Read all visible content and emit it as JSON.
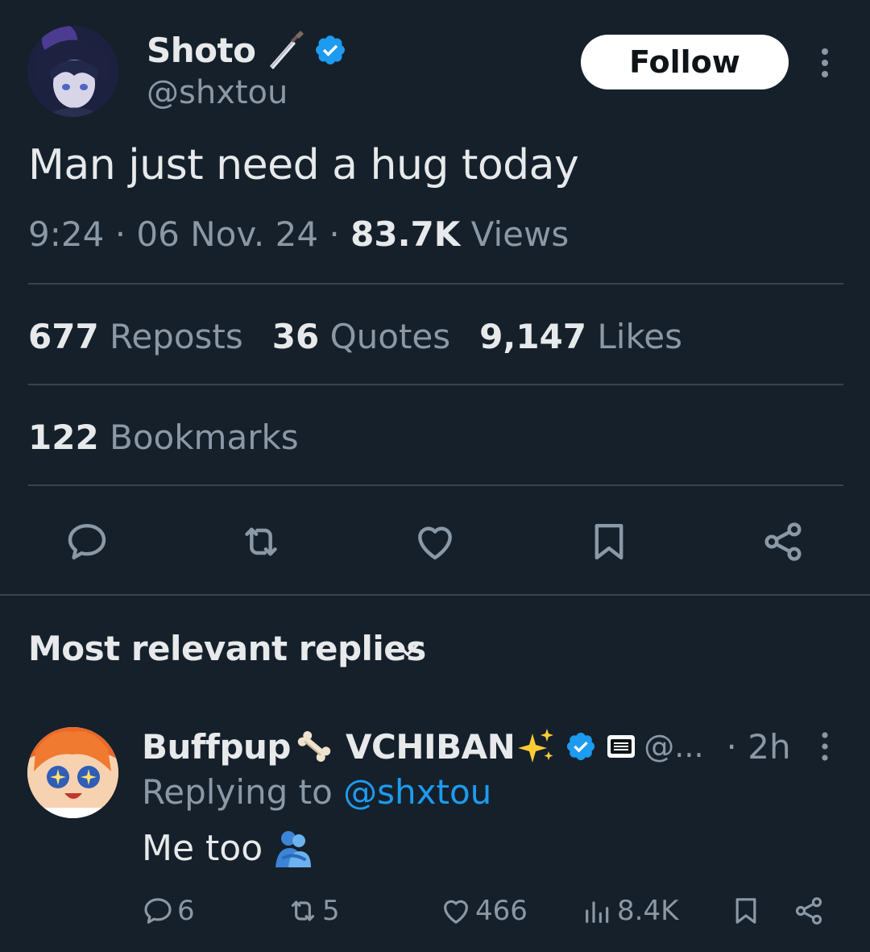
{
  "tweet": {
    "author": {
      "name": "Shoto",
      "handle": "@shxtou",
      "verified": true
    },
    "follow_label": "Follow",
    "text": "Man just need a hug today",
    "time": "9:24",
    "date": "06 Nov. 24",
    "views_count": "83.7K",
    "views_label": "Views",
    "separator": "·",
    "stats": {
      "reposts_count": "677",
      "reposts_label": "Reposts",
      "quotes_count": "36",
      "quotes_label": "Quotes",
      "likes_count": "9,147",
      "likes_label": "Likes",
      "bookmarks_count": "122",
      "bookmarks_label": "Bookmarks"
    },
    "actions": [
      "reply-icon",
      "repost-icon",
      "like-icon",
      "bookmark-icon",
      "share-icon"
    ]
  },
  "replies": {
    "title": "Most relevant replies",
    "items": [
      {
        "name_part1": "Buffpup",
        "name_part2": "VCHIBAN",
        "handle": "@...",
        "time": "· 2h",
        "replying_prefix": "Replying to",
        "replying_handle": "@shxtou",
        "text": "Me too",
        "replies": "6",
        "reposts": "5",
        "likes": "466",
        "views": "8.4K"
      }
    ]
  },
  "colors": {
    "background": "#15202b",
    "text": "#e7e9ea",
    "muted": "#8b98a5",
    "accent": "#1d9bf0",
    "divider": "#38444d"
  }
}
